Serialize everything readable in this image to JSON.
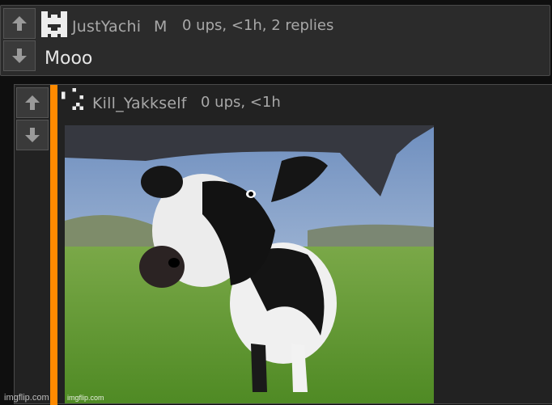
{
  "comments": [
    {
      "username": "JustYachi",
      "badge": "M",
      "meta": "0 ups, <1h, 2 replies",
      "text": "Mooo"
    }
  ],
  "reply": {
    "username": "Kill_Yakkself",
    "meta": "0 ups, <1h",
    "image": {
      "description_icon": "cow-photo-meme",
      "watermark": "imgflip.com"
    }
  },
  "footer": {
    "watermark": "imgflip.com"
  },
  "colors": {
    "reply_bar": "#ff8a00",
    "panel": "#2b2b2b",
    "text_muted": "#a8a8a8"
  }
}
